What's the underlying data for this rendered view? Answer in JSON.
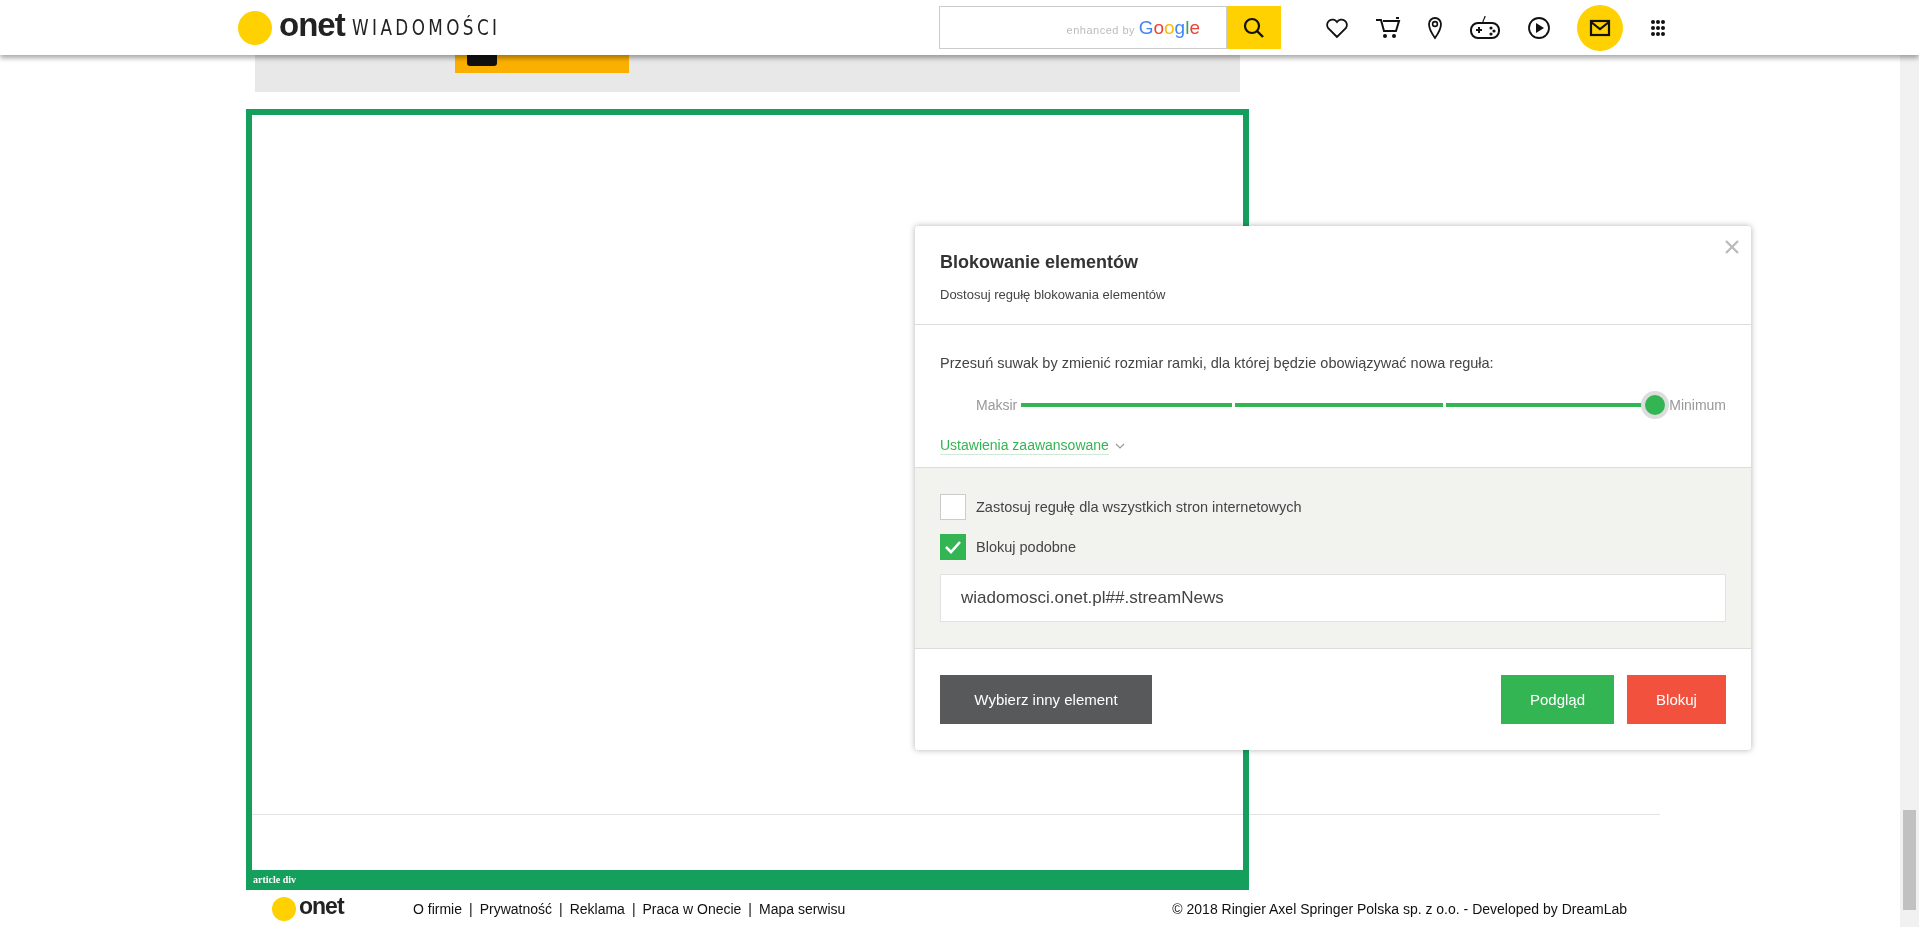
{
  "header": {
    "logo": "onet",
    "section": "WIADOMOŚCI",
    "search": {
      "branding_prefix": "enhanced by",
      "branding": "Google"
    }
  },
  "article_frame": {
    "label": "article div"
  },
  "dialog": {
    "title": "Blokowanie elementów",
    "subtitle": "Dostosuj regułę blokowania elementów",
    "slider": {
      "instruction": "Przesuń suwak by zmienić rozmiar ramki, dla której będzie obowiązywać nowa reguła:",
      "min_label": "Maksir",
      "max_label": "Minimum",
      "level": 1
    },
    "advanced_link": "Ustawienia zaawansowane",
    "options": [
      {
        "label": "Zastosuj regułę dla wszystkich stron internetowych",
        "checked": false
      },
      {
        "label": "Blokuj podobne",
        "checked": true
      }
    ],
    "rule": "wiadomosci.onet.pl##.streamNews",
    "buttons": [
      {
        "label": "Wybierz inny element",
        "kind": "secondary"
      },
      {
        "label": "Podgląd",
        "kind": "preview"
      },
      {
        "label": "Blokuj",
        "kind": "danger"
      }
    ]
  },
  "footer": {
    "logo": "onet",
    "separator": "|",
    "links": [
      "O firmie",
      "Prywatność",
      "Reklama",
      "Praca w Onecie",
      "Mapa serwisu"
    ],
    "copyright": "© 2018 Ringier Axel Springer Polska sp. z o.o. - Developed by DreamLab"
  }
}
